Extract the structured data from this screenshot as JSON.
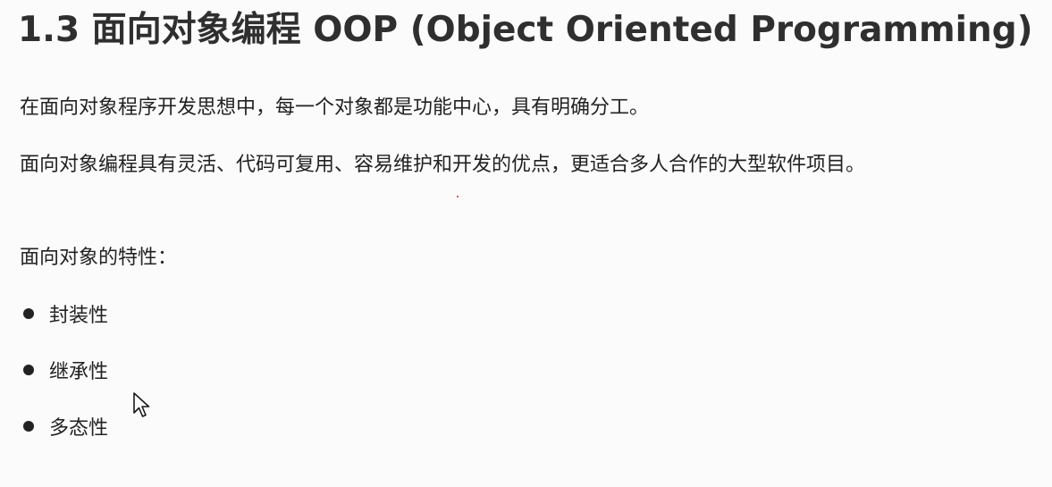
{
  "title": "1.3 面向对象编程 OOP (Object Oriented Programming)",
  "paragraphs": [
    "在面向对象程序开发思想中，每一个对象都是功能中心，具有明确分工。",
    "面向对象编程具有灵活、代码可复用、容易维护和开发的优点，更适合多人合作的大型软件项目。",
    "面向对象的特性："
  ],
  "features": [
    "封装性",
    "继承性",
    "多态性"
  ],
  "icons": {
    "bullet": "filled-circle",
    "cursor": "mouse-pointer-arrow",
    "marker": "red-dot"
  },
  "colors": {
    "background": "#fbfbfb",
    "text": "#222222",
    "heading": "#2f2f2f",
    "marker": "#e02020"
  }
}
